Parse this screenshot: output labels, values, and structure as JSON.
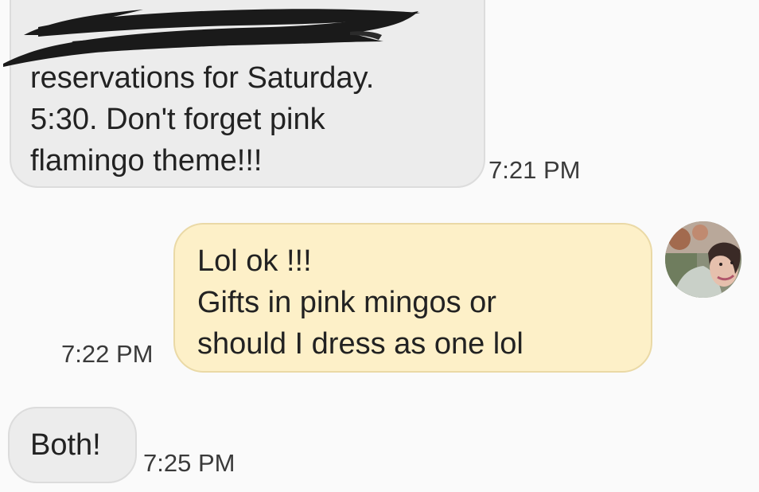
{
  "messages": [
    {
      "direction": "incoming",
      "lines": [
        "reservations for Saturday.",
        "5:30. Don't forget pink",
        "flamingo theme!!!"
      ],
      "time": "7:21 PM"
    },
    {
      "direction": "outgoing",
      "lines": [
        "Lol ok !!!",
        "Gifts in pink mingos or",
        "should I dress as one lol"
      ],
      "time": "7:22 PM"
    },
    {
      "direction": "incoming",
      "lines": [
        "Both!"
      ],
      "time": "7:25 PM"
    }
  ],
  "avatar": {
    "icon": "contact-photo"
  },
  "colors": {
    "background": "#fafafa",
    "incoming_bubble": "#ececec",
    "outgoing_bubble": "#fdf0c8",
    "outgoing_border": "#ead9a6",
    "text": "#222222",
    "timestamp": "#3a3a3a",
    "redaction": "#1a1a1a"
  }
}
